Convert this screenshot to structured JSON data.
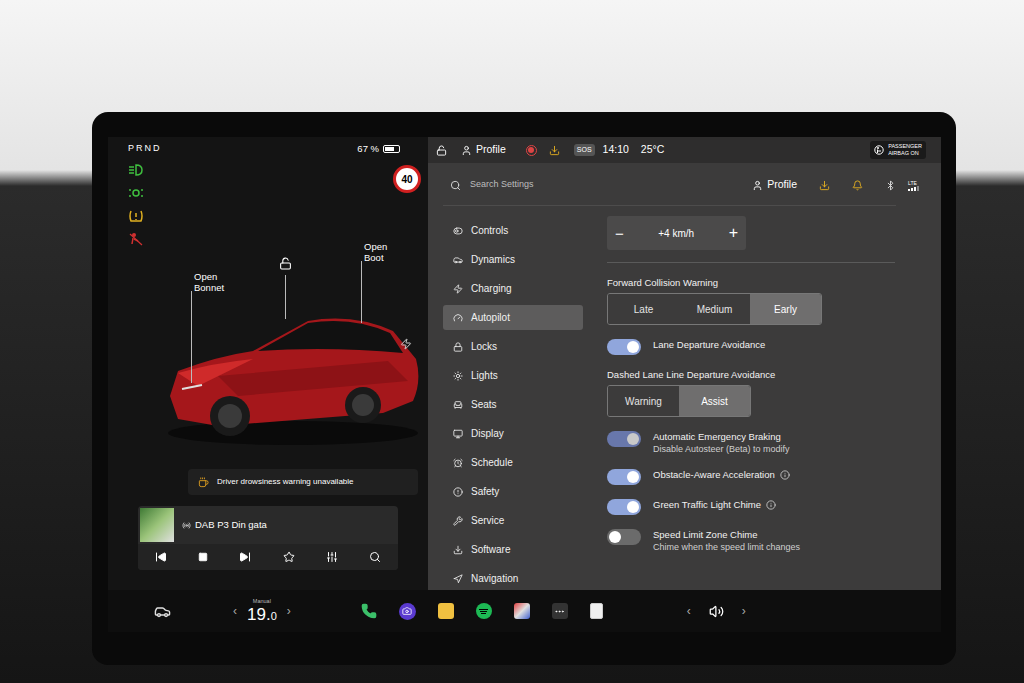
{
  "left_panel": {
    "gear": "PRND",
    "battery": "67 %",
    "battery_level": 0.67,
    "speed_limit": "40",
    "car_labels": {
      "bonnet": "Open Bonnet",
      "boot": "Open Boot"
    },
    "notice": "Driver drowsiness warning unavailable",
    "media": {
      "station": "DAB P3 Din gata"
    }
  },
  "status_bar": {
    "profile": "Profile",
    "sos": "SOS",
    "time": "14:10",
    "temperature": "25°C",
    "airbag": {
      "line1": "PASSENGER",
      "line2": "AIRBAG ON"
    }
  },
  "search_row": {
    "placeholder": "Search Settings",
    "profile": "Profile",
    "network": "LTE"
  },
  "sidebar": {
    "items": [
      {
        "label": "Controls",
        "selected": false
      },
      {
        "label": "Dynamics",
        "selected": false
      },
      {
        "label": "Charging",
        "selected": false
      },
      {
        "label": "Autopilot",
        "selected": true
      },
      {
        "label": "Locks",
        "selected": false
      },
      {
        "label": "Lights",
        "selected": false
      },
      {
        "label": "Seats",
        "selected": false
      },
      {
        "label": "Display",
        "selected": false
      },
      {
        "label": "Schedule",
        "selected": false
      },
      {
        "label": "Safety",
        "selected": false
      },
      {
        "label": "Service",
        "selected": false
      },
      {
        "label": "Software",
        "selected": false
      },
      {
        "label": "Navigation",
        "selected": false
      }
    ]
  },
  "settings": {
    "rows": [
      {
        "kind": "stepper",
        "value": "+4 km/h",
        "minus": "−",
        "plus": "+"
      },
      {
        "kind": "segmented",
        "title": "Forward Collision Warning",
        "options": [
          {
            "label": "Late",
            "selected": false
          },
          {
            "label": "Medium",
            "selected": false
          },
          {
            "label": "Early",
            "selected": true
          }
        ]
      },
      {
        "kind": "toggle",
        "label": "Lane Departure Avoidance",
        "sub": "",
        "on": true,
        "disabled": false,
        "info": false
      },
      {
        "kind": "segmented",
        "title": "Dashed Lane Line Departure Avoidance",
        "options": [
          {
            "label": "Warning",
            "selected": false
          },
          {
            "label": "Assist",
            "selected": true
          }
        ]
      },
      {
        "kind": "toggle",
        "label": "Automatic Emergency Braking",
        "sub": "Disable Autosteer (Beta) to modify",
        "on": true,
        "disabled": true,
        "info": false
      },
      {
        "kind": "toggle",
        "label": "Obstacle-Aware Acceleration",
        "sub": "",
        "on": true,
        "disabled": false,
        "info": true
      },
      {
        "kind": "toggle",
        "label": "Green Traffic Light Chime",
        "sub": "",
        "on": true,
        "disabled": false,
        "info": true
      },
      {
        "kind": "toggle",
        "label": "Speed Limit Zone Chime",
        "sub": "Chime when the speed limit changes",
        "on": false,
        "disabled": false,
        "info": false
      }
    ]
  },
  "bottom_bar": {
    "mode": "Manual",
    "temp_whole": "19.",
    "temp_decimal": "0",
    "left_arrow": "‹",
    "right_arrow": "›",
    "volume_left": "‹",
    "volume_right": "›"
  }
}
